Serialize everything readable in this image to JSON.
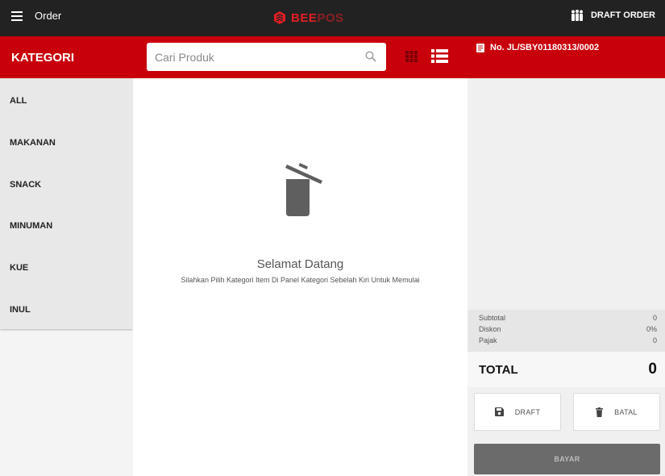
{
  "header": {
    "menu_label": "Order",
    "logo": {
      "bee": "BEE",
      "pos": "POS"
    },
    "draft_order_label": "DRAFT ORDER"
  },
  "colors": {
    "primary_red": "#c8000b",
    "topbar": "#222222"
  },
  "sidebar": {
    "title": "KATEGORI",
    "items": [
      {
        "label": "ALL"
      },
      {
        "label": "MAKANAN"
      },
      {
        "label": "SNACK"
      },
      {
        "label": "MINUMAN"
      },
      {
        "label": "KUE"
      },
      {
        "label": "INUL"
      }
    ]
  },
  "search": {
    "placeholder": "Cari Produk",
    "value": ""
  },
  "main": {
    "welcome_title": "Selamat Datang",
    "welcome_subtitle": "Silahkan Pilih Kategori Item Di Panel Kategori Sebelah Kiri Untuk Memulai"
  },
  "receipt": {
    "number": "No. JL/SBY01180313/0002",
    "subtotal_label": "Subtotal",
    "subtotal_value": "0",
    "discount_label": "Diskon",
    "discount_value": "0%",
    "tax_label": "Pajak",
    "tax_value": "0",
    "total_label": "TOTAL",
    "total_value": "0",
    "draft_label": "DRAFT",
    "cancel_label": "BATAL",
    "pay_label": "BAYAR"
  }
}
